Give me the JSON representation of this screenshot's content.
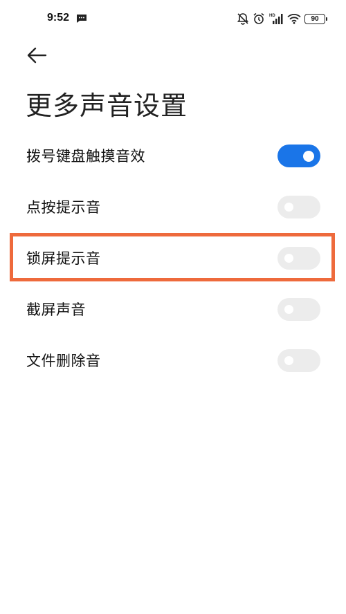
{
  "status_bar": {
    "time": "9:52",
    "battery": "90",
    "network_label": "HD"
  },
  "header": {
    "title": "更多声音设置"
  },
  "settings": [
    {
      "label": "拨号键盘触摸音效",
      "enabled": true
    },
    {
      "label": "点按提示音",
      "enabled": false
    },
    {
      "label": "锁屏提示音",
      "enabled": false
    },
    {
      "label": "截屏声音",
      "enabled": false
    },
    {
      "label": "文件删除音",
      "enabled": false
    }
  ],
  "colors": {
    "accent": "#1a75e8",
    "toggle_off": "#ececec",
    "highlight": "#ee6a3c"
  },
  "highlighted_item": "锁屏提示音"
}
